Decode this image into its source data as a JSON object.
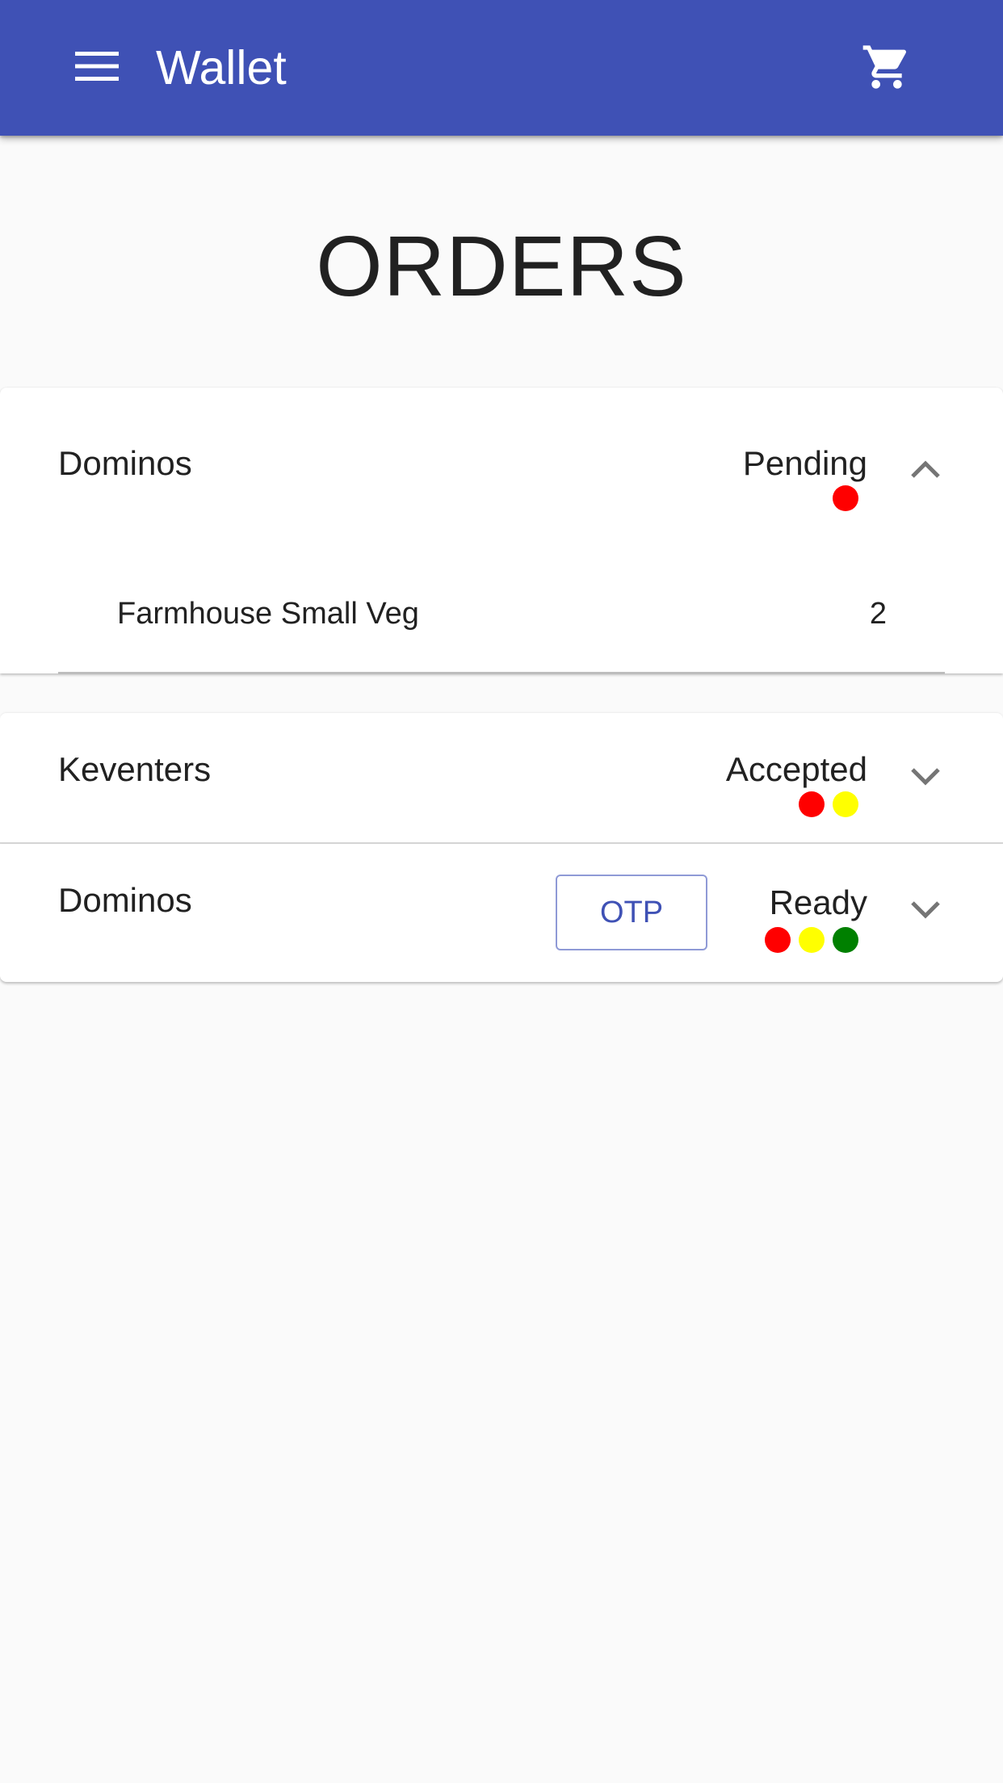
{
  "appbar": {
    "title": "Wallet",
    "menu_icon": "menu-icon",
    "cart_icon": "cart-icon",
    "background_color": "#3f51b5"
  },
  "page": {
    "heading": "ORDERS"
  },
  "orders": [
    {
      "store": "Dominos",
      "status": "Pending",
      "status_dots": [
        "#ff0000"
      ],
      "expanded": true,
      "chevron_icon": "chevron-up-icon",
      "items": [
        {
          "name": "Farmhouse Small Veg",
          "quantity": "2"
        }
      ]
    },
    {
      "store": "Keventers",
      "status": "Accepted",
      "status_dots": [
        "#ff0000",
        "#ffff00"
      ],
      "expanded": false,
      "chevron_icon": "chevron-down-icon"
    },
    {
      "store": "Dominos",
      "status": "Ready",
      "status_dots": [
        "#ff0000",
        "#ffff00",
        "#008000"
      ],
      "expanded": false,
      "chevron_icon": "chevron-down-icon",
      "otp_button_label": "OTP"
    }
  ]
}
